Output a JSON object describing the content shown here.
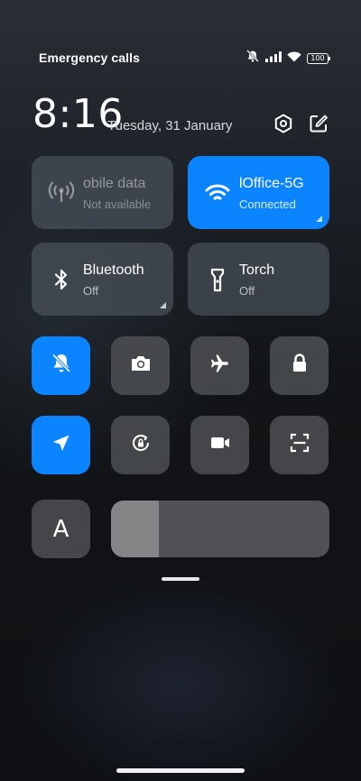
{
  "status_bar": {
    "carrier": "Emergency calls",
    "icons": [
      "mute-icon",
      "signal-icon",
      "wifi-icon"
    ],
    "battery": "100"
  },
  "header": {
    "time": "8:16",
    "date": "Tuesday, 31 January",
    "settings_icon": "settings-icon",
    "edit_icon": "edit-icon"
  },
  "tiles": {
    "mobile_data": {
      "title": "obile data",
      "subtitle": "Not available"
    },
    "wifi": {
      "title": "lOffice-5G",
      "subtitle": "Connected"
    },
    "bluetooth": {
      "title": "Bluetooth",
      "subtitle": "Off"
    },
    "torch": {
      "title": "Torch",
      "subtitle": "Off"
    }
  },
  "toggles": [
    {
      "name": "silent-mode",
      "active": true
    },
    {
      "name": "screenshot",
      "active": false
    },
    {
      "name": "airplane-mode",
      "active": false
    },
    {
      "name": "lock-screen",
      "active": false
    },
    {
      "name": "location",
      "active": true
    },
    {
      "name": "auto-rotate",
      "active": false
    },
    {
      "name": "screen-recorder",
      "active": false
    },
    {
      "name": "scanner",
      "active": false
    }
  ],
  "brightness": {
    "auto_label": "A",
    "level": 0.22
  },
  "colors": {
    "accent": "#0a84ff",
    "tile_bg": "#58606a"
  }
}
